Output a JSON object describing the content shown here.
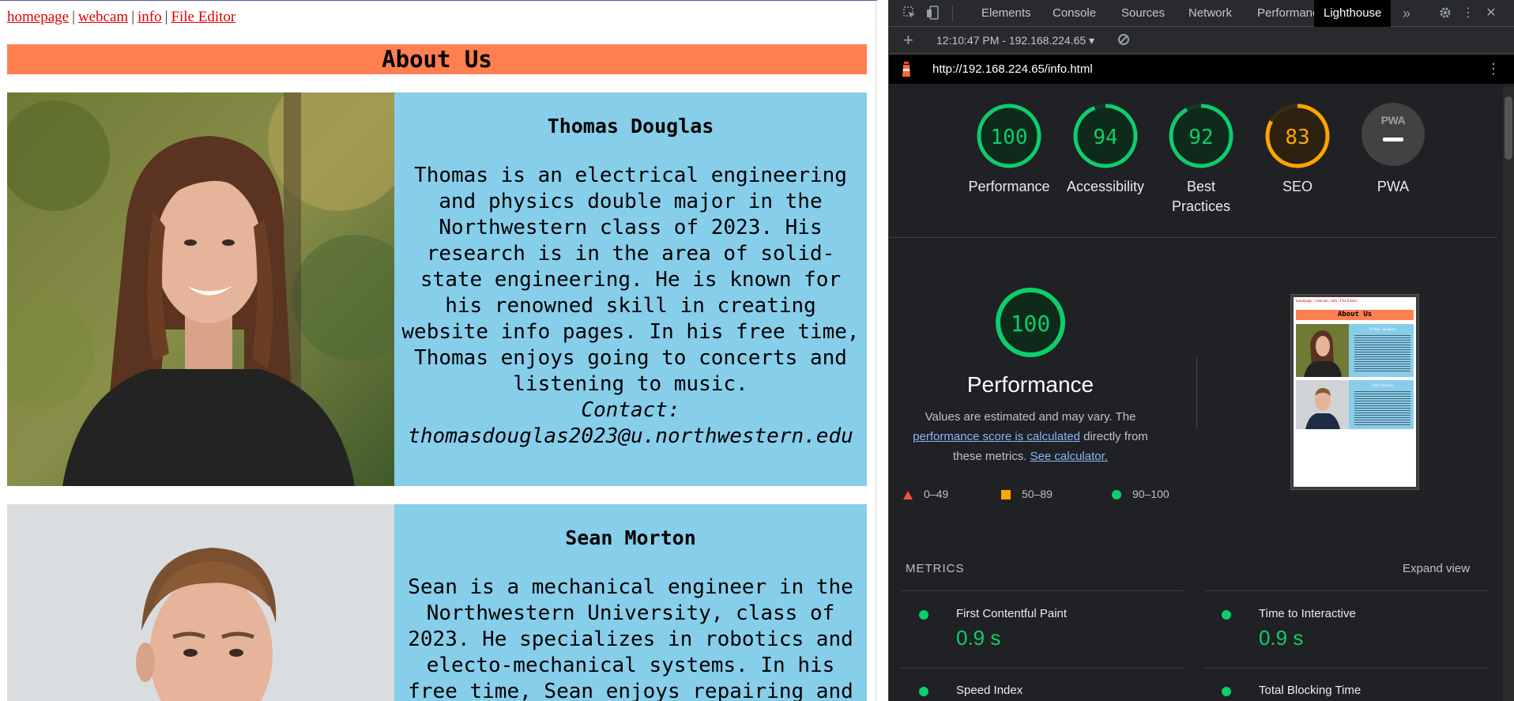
{
  "page": {
    "nav": {
      "links": [
        "homepage",
        "webcam",
        "info",
        "File Editor"
      ],
      "separator": "|"
    },
    "heading": "About Us",
    "people": [
      {
        "name": "Thomas Douglas",
        "bio": "Thomas is an electrical engineering and physics double major in the Northwestern class of 2023. His research is in the area of solid-state engineering. He is known for his renowned skill in creating website info pages. In his free time, Thomas enjoys going to concerts and listening to music.",
        "contact_label": "Contact:",
        "contact_email": "thomasdouglas2023@u.northwestern.edu"
      },
      {
        "name": "Sean Morton",
        "bio": "Sean is a mechanical engineer in the Northwestern University, class of 2023. He specializes in robotics and electo-mechanical systems. In his free time, Sean enjoys repairing and"
      }
    ],
    "colors": {
      "heading_bg": "#ff7f50",
      "person_bg": "#87ceeb",
      "link": "#e00000"
    }
  },
  "devtools": {
    "tabs": [
      "Elements",
      "Console",
      "Sources",
      "Network",
      "Performance",
      "Lighthouse"
    ],
    "active_tab": "Lighthouse",
    "report_label": "12:10:47 PM - 192.168.224.65",
    "url": "http://192.168.224.65/info.html",
    "gauges": [
      {
        "score": "100",
        "label": "Performance",
        "value": 100,
        "color": "#0cce6b"
      },
      {
        "score": "94",
        "label": "Accessibility",
        "value": 94,
        "color": "#0cce6b"
      },
      {
        "score": "92",
        "label": "Best Practices",
        "value": 92,
        "color": "#0cce6b"
      },
      {
        "score": "83",
        "label": "SEO",
        "value": 83,
        "color": "#ffa400"
      }
    ],
    "pwa": {
      "badge": "PWA",
      "label": "PWA"
    },
    "performance": {
      "score": "100",
      "title": "Performance",
      "desc_1": "Values are estimated and may vary. The",
      "desc_link": "performance score is calculated",
      "desc_2": "directly from these metrics.",
      "calc_link": "See calculator."
    },
    "legend": [
      "0–49",
      "50–89",
      "90–100"
    ],
    "metrics_title": "METRICS",
    "expand_label": "Expand view",
    "metrics": [
      {
        "name": "First Contentful Paint",
        "value": "0.9 s"
      },
      {
        "name": "Time to Interactive",
        "value": "0.9 s"
      },
      {
        "name": "Speed Index",
        "value": ""
      },
      {
        "name": "Total Blocking Time",
        "value": ""
      }
    ],
    "thumbnail": {
      "nav": "homepage | webcam | info | File Editor",
      "heading": "About Us",
      "name_1": "Thomas Douglas",
      "name_2": "Sean Morton"
    }
  }
}
